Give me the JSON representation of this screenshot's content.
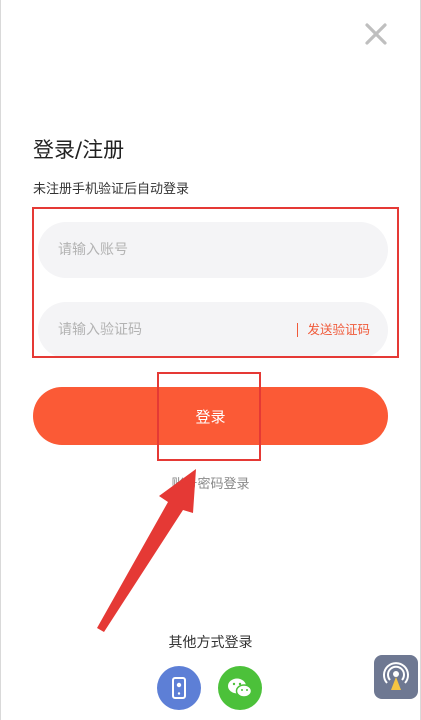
{
  "header": {
    "close_icon": "close-icon"
  },
  "title": "登录/注册",
  "subtitle": "未注册手机验证后自动登录",
  "form": {
    "account_placeholder": "请输入账号",
    "code_placeholder": "请输入验证码",
    "send_code_label": "发送验证码"
  },
  "login_button_label": "登录",
  "password_login_label": "账号密码登录",
  "other_login": {
    "title": "其他方式登录",
    "methods": [
      {
        "icon": "phone-icon",
        "color": "#5d7fd6"
      },
      {
        "icon": "wechat-icon",
        "color": "#4cc13a"
      }
    ]
  },
  "colors": {
    "accent": "#fb5a36",
    "annotation_red": "#e53935",
    "field_bg": "#f4f4f6"
  }
}
